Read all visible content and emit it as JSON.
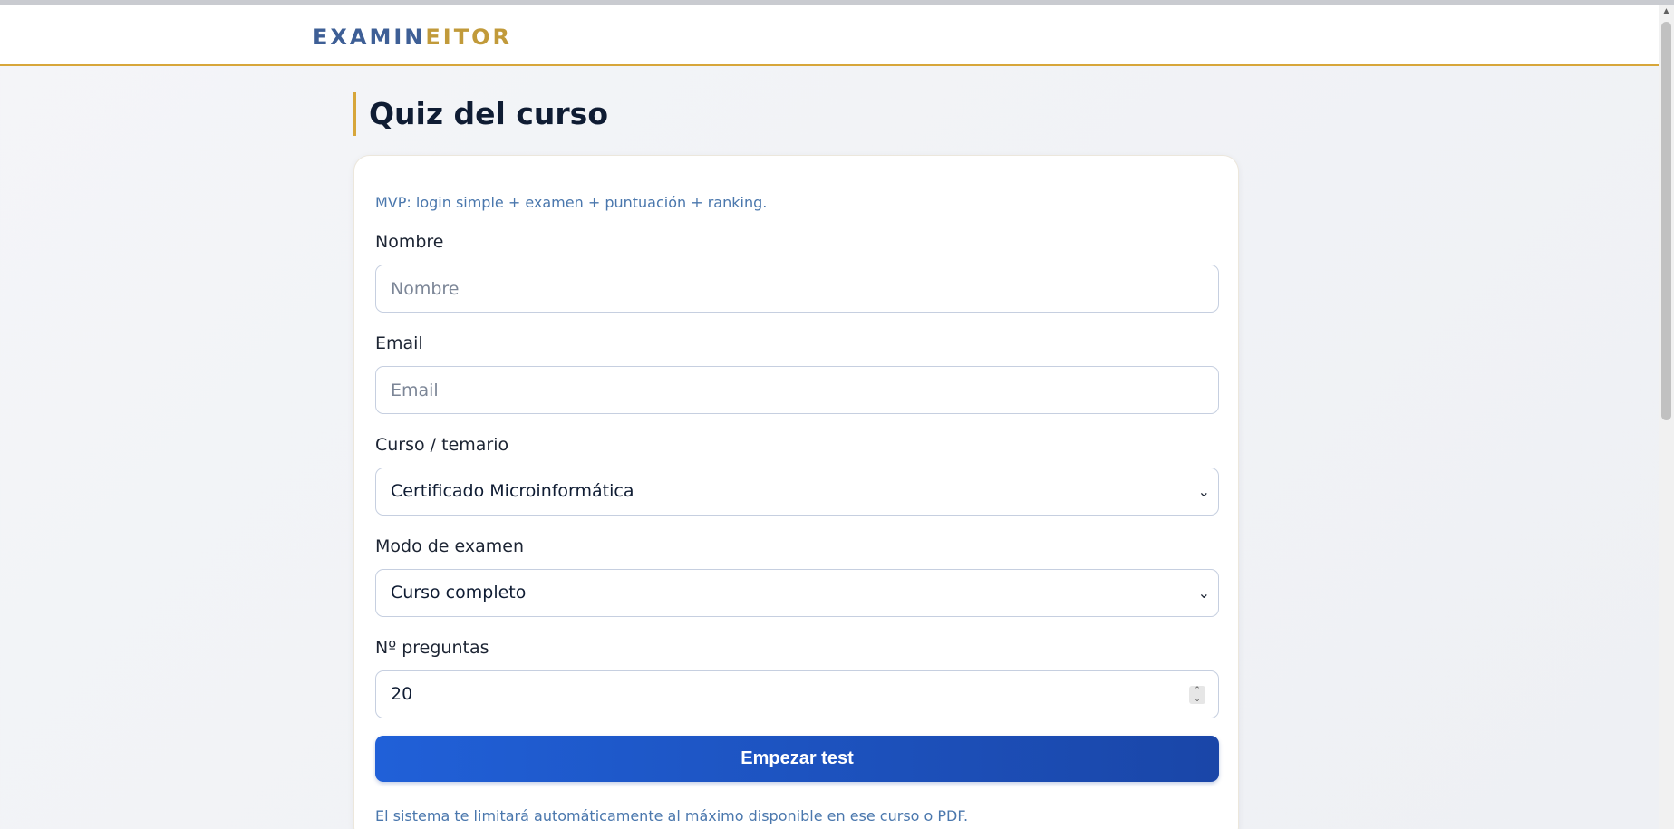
{
  "header": {
    "logo_part1": "EXAMIN",
    "logo_part2": "EITOR"
  },
  "page": {
    "title": "Quiz del curso"
  },
  "form": {
    "intro": "MVP: login simple + examen + puntuación + ranking.",
    "name_label": "Nombre",
    "name_placeholder": "Nombre",
    "email_label": "Email",
    "email_placeholder": "Email",
    "course_label": "Curso / temario",
    "course_value": "Certificado Microinformática",
    "mode_label": "Modo de examen",
    "mode_value": "Curso completo",
    "questions_label": "Nº preguntas",
    "questions_value": "20",
    "start_button": "Empezar test",
    "footer_note": "El sistema te limitará automáticamente al máximo disponible en ese curso o PDF."
  },
  "colors": {
    "accent": "#d7a63a",
    "primary": "#2060d8",
    "logo_blue": "#3e5f96",
    "logo_gold": "#c19a3a"
  },
  "icons": {
    "select_arrow": "chevron-down-icon",
    "number_spinner": "spinner-arrows-icon"
  }
}
